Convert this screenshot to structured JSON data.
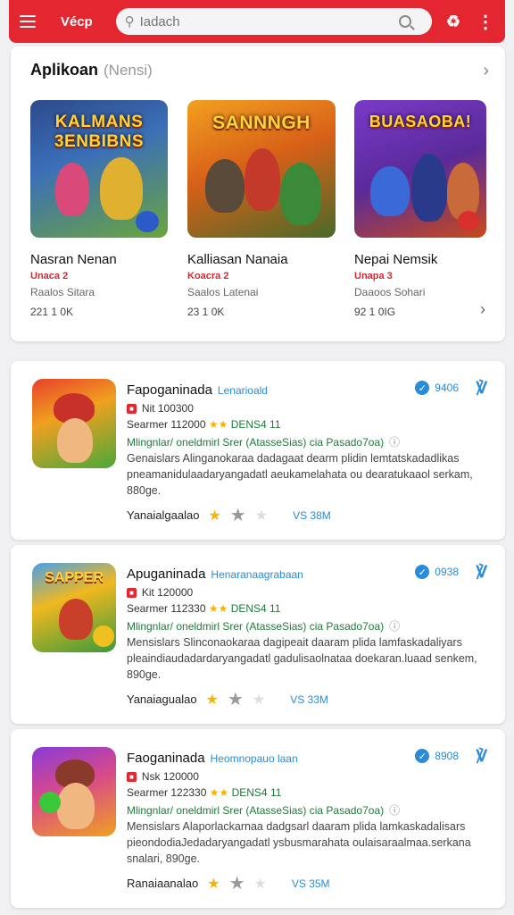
{
  "header": {
    "logo": "Vécp",
    "search_placeholder": "Iadach"
  },
  "featured": {
    "title": "Aplikoan",
    "subtitle": "(Nensi)",
    "items": [
      {
        "art_title": "KALMANS 3ENBIBNS",
        "name": "Nasran Nenan",
        "badge": "Unaca 2",
        "dev": "Raalos Sitara",
        "size": "221 1 0K"
      },
      {
        "art_title": "SANNNGH",
        "name": "Kalliasan Nanaia",
        "badge": "Koacra 2",
        "dev": "Saalos Latenai",
        "size": "23 1 0K"
      },
      {
        "art_title": "BUASAOBA!",
        "name": "Nepai Nemsik",
        "badge": "Unapa 3",
        "dev": "Daaoos Sohari",
        "size": "92 1 0IG"
      }
    ]
  },
  "cards": [
    {
      "title": "Fapoganinada",
      "dev": "Lenarioald",
      "verified": "9406",
      "rating_line": "Nit 100300",
      "stats": "Searmer 112000",
      "downloads": "DENS4 11",
      "languages": "Mlingnlar/ oneldmirl   Srer (AtasseSias) cia Pasado7oa)",
      "desc": "Genaislars Alinganokaraa dadagaat dearm plidin lemtatskadadlikas pneamanidulaadaryangadatl aeukamelahata ou dearatukaaol serkam, 880ge.",
      "rating_label": "Yanaialgaalao",
      "size": "VS 38M"
    },
    {
      "title": "Apuganinada",
      "dev": "Henaranaagrabaan",
      "verified": "0938",
      "rating_line": "Kit 120000",
      "stats": "Searmer 112330",
      "downloads": "DENS4 11",
      "languages": "Mlingnlar/ oneldmirl   Srer (AtasseSias) cia Pasado7oa)",
      "desc": "Mensislars Slinconaokaraa dagipeait daaram plida lamfaskadaliyars pleaindiaudadardaryangadatl gadulisaolnataa doekaran.luaad senkem, 890ge.",
      "rating_label": "Yanaiagualao",
      "size": "VS 33M"
    },
    {
      "title": "Faoganinada",
      "dev": "Heomnopauo laan",
      "verified": "8908",
      "rating_line": "Nsk 120000",
      "stats": "Searmer 122330",
      "downloads": "DENS4 11",
      "languages": "Mlingnlar/ oneldmirl   Srer (AtasseSias) cia Pasado7oa)",
      "desc": "Mensislars Alaporlackarnaa dadgsarl daaram plida lamkaskadalisars pieondodiaJedadaryangadatl ysbusmarahata oulaisaraalmaa.serkana snalari, 890ge.",
      "rating_label": "Ranaiaanalao",
      "size": "VS 35M"
    }
  ],
  "colors": {
    "accent": "#e3262f",
    "link": "#2a8bd8",
    "star": "#f4b400"
  }
}
